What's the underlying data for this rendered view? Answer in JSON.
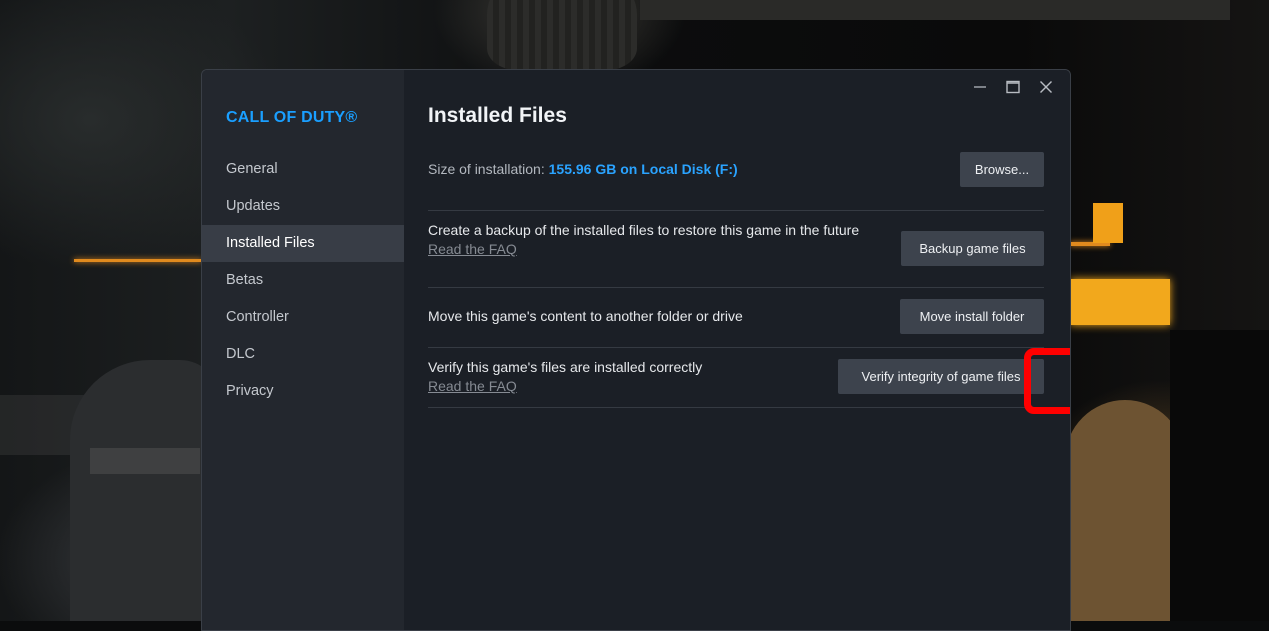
{
  "sidebar": {
    "game_title": "CALL OF DUTY®",
    "items": [
      {
        "label": "General"
      },
      {
        "label": "Updates"
      },
      {
        "label": "Installed Files",
        "active": true
      },
      {
        "label": "Betas"
      },
      {
        "label": "Controller"
      },
      {
        "label": "DLC"
      },
      {
        "label": "Privacy"
      }
    ]
  },
  "window_controls": {
    "minimize": "—",
    "maximize": "☐",
    "close": "✕"
  },
  "page": {
    "title": "Installed Files",
    "size_row": {
      "label": "Size of installation: ",
      "value": "155.96 GB on Local Disk (F:)",
      "button": "Browse..."
    },
    "backup_row": {
      "text": "Create a backup of the installed files to restore this game in the future",
      "link": "Read the FAQ",
      "button": "Backup game files"
    },
    "move_row": {
      "text": "Move this game's content to another folder or drive",
      "button": "Move install folder"
    },
    "verify_row": {
      "text": "Verify this game's files are installed correctly",
      "link": "Read the FAQ",
      "button": "Verify integrity of game files"
    }
  },
  "colors": {
    "accent": "#1a9fff",
    "highlight": "#ff0000",
    "window_bg": "#1b1f26",
    "sidebar_bg": "#23272e"
  }
}
